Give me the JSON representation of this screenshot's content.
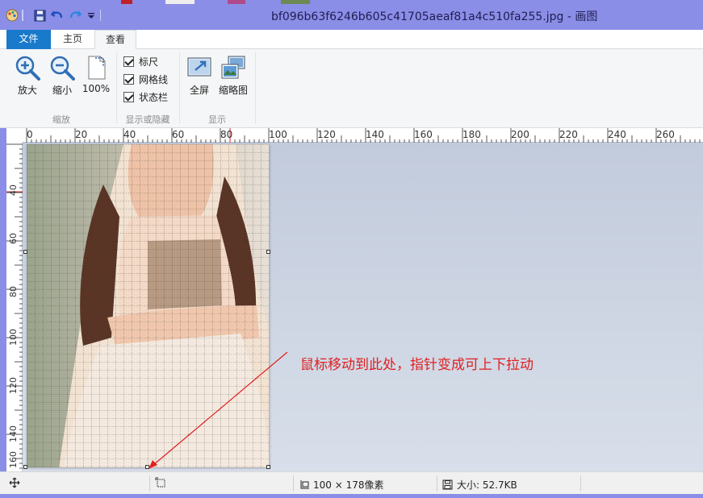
{
  "window": {
    "title": "bf096b63f6246b605c41705aeaf81a4c510fa255.jpg - 画图",
    "title_bar_color": "#8b8ee6"
  },
  "quick_access": {
    "icons": [
      "paint-app-icon",
      "save-icon",
      "undo-icon",
      "redo-icon",
      "customize-dropdown-icon"
    ]
  },
  "tabs": {
    "file": "文件",
    "home": "主页",
    "view": "查看",
    "active": "查看"
  },
  "ribbon": {
    "zoom": {
      "group_label": "缩放",
      "zoom_in": "放大",
      "zoom_out": "缩小",
      "actual_size": "100%"
    },
    "show_hide": {
      "group_label": "显示或隐藏",
      "ruler": "标尺",
      "gridlines": "网格线",
      "statusbar": "状态栏",
      "ruler_checked": true,
      "gridlines_checked": true,
      "statusbar_checked": true
    },
    "display": {
      "group_label": "显示",
      "fullscreen": "全屏",
      "thumbnail": "缩略图"
    }
  },
  "rulers": {
    "horizontal": [
      "0",
      "20",
      "40",
      "60",
      "80",
      "100",
      "120",
      "140",
      "160",
      "180",
      "200",
      "220",
      "240",
      "260"
    ],
    "vertical": [
      "40",
      "60",
      "80",
      "100",
      "120",
      "140",
      "160"
    ]
  },
  "annotation": {
    "text": "鼠标移动到此处，指针变成可上下拉动",
    "color": "#e02020"
  },
  "statusbar": {
    "image_size": "100 × 178像素",
    "file_size": "大小: 52.7KB"
  }
}
